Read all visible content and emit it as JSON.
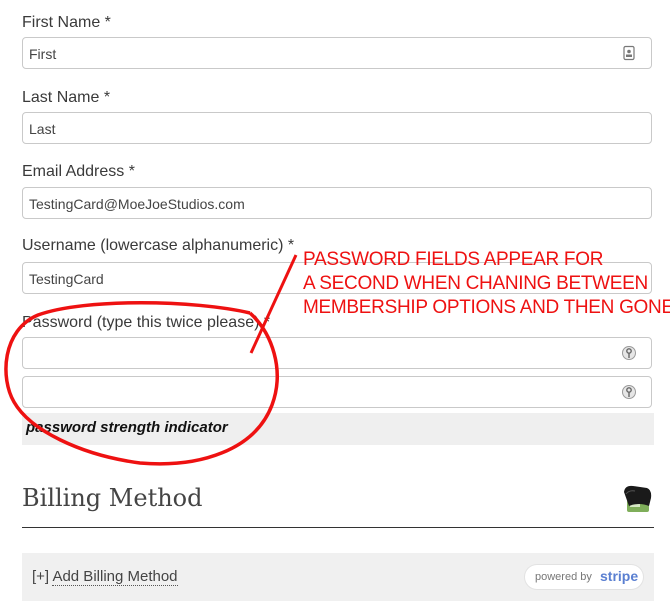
{
  "form": {
    "first_name_label": "First Name *",
    "first_name_value": "First",
    "last_name_label": "Last Name *",
    "last_name_value": "Last",
    "email_label": "Email Address *",
    "email_value": "TestingCard@MoeJoeStudios.com",
    "username_label": "Username (lowercase alphanumeric) *",
    "username_value": "TestingCard",
    "password_label": "Password (type this twice please) *",
    "password_value": "",
    "password_confirm_value": "",
    "strength_text": "password strength indicator"
  },
  "billing": {
    "title": "Billing Method",
    "add_prefix": "[+]",
    "add_label": "Add Billing Method",
    "powered_by": "powered by",
    "stripe": "stripe"
  },
  "annotation": {
    "line1": "PASSWORD FIELDS APPEAR FOR",
    "line2": "A SECOND WHEN CHANING BETWEEN",
    "line3": "MEMBERSHIP OPTIONS AND THEN GONE",
    "color": "#ee1111"
  },
  "icons": [
    "contact-card-icon",
    "key-icon",
    "wallet-icon"
  ]
}
